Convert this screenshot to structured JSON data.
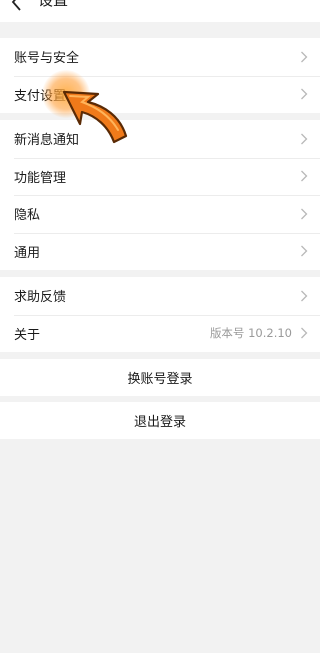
{
  "header": {
    "title": "设置",
    "back_icon": "chevron-left-icon"
  },
  "group1": {
    "items": [
      {
        "label": "账号与安全"
      },
      {
        "label": "支付设置"
      }
    ]
  },
  "group2": {
    "items": [
      {
        "label": "新消息通知"
      },
      {
        "label": "功能管理"
      },
      {
        "label": "隐私"
      },
      {
        "label": "通用"
      }
    ]
  },
  "group3": {
    "items": [
      {
        "label": "求助反馈"
      },
      {
        "label": "关于",
        "extra": "版本号 10.2.10"
      }
    ]
  },
  "actions": {
    "switch_account": "换账号登录",
    "logout": "退出登录"
  },
  "colors": {
    "background": "#f2f2f2",
    "row": "#ffffff",
    "chevron": "#b8b8b8",
    "highlight_arrow": "#f07a1a"
  }
}
